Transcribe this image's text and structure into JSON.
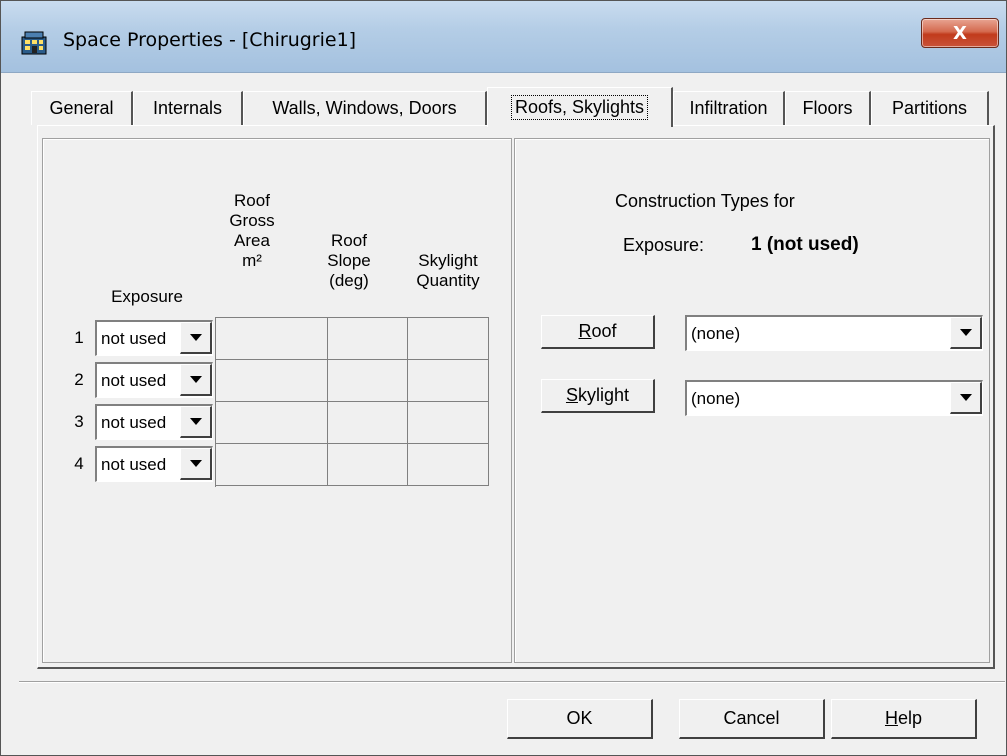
{
  "window": {
    "title": "Space Properties - [Chirugrie1]",
    "close_label": "X"
  },
  "tabs": [
    {
      "label": "General"
    },
    {
      "label": "Internals"
    },
    {
      "label": "Walls, Windows, Doors"
    },
    {
      "label": "Roofs, Skylights",
      "active": true
    },
    {
      "label": "Infiltration"
    },
    {
      "label": "Floors"
    },
    {
      "label": "Partitions"
    }
  ],
  "table": {
    "headers": {
      "exposure": "Exposure",
      "area": "Roof\nGross\nArea\nm²",
      "slope": "Roof\nSlope\n(deg)",
      "skylight": "Skylight\nQuantity"
    },
    "rows": [
      {
        "num": "1",
        "exposure": "not used",
        "area": "",
        "slope": "",
        "quantity": ""
      },
      {
        "num": "2",
        "exposure": "not used",
        "area": "",
        "slope": "",
        "quantity": ""
      },
      {
        "num": "3",
        "exposure": "not used",
        "area": "",
        "slope": "",
        "quantity": ""
      },
      {
        "num": "4",
        "exposure": "not used",
        "area": "",
        "slope": "",
        "quantity": ""
      }
    ]
  },
  "construction": {
    "heading": "Construction Types for",
    "exposure_label": "Exposure:",
    "exposure_value": "1 (not used)",
    "roof_button": {
      "mnemonic": "R",
      "rest": "oof"
    },
    "roof_value": "(none)",
    "skylight_button": {
      "mnemonic": "S",
      "rest": "kylight"
    },
    "skylight_value": "(none)"
  },
  "footer": {
    "ok": "OK",
    "cancel": "Cancel",
    "help": {
      "mnemonic": "H",
      "rest": "elp"
    }
  },
  "colors": {
    "dialog_bg": "#f0f0f0",
    "close_button": "#c13b1c",
    "titlebar": "#b4cde6"
  }
}
